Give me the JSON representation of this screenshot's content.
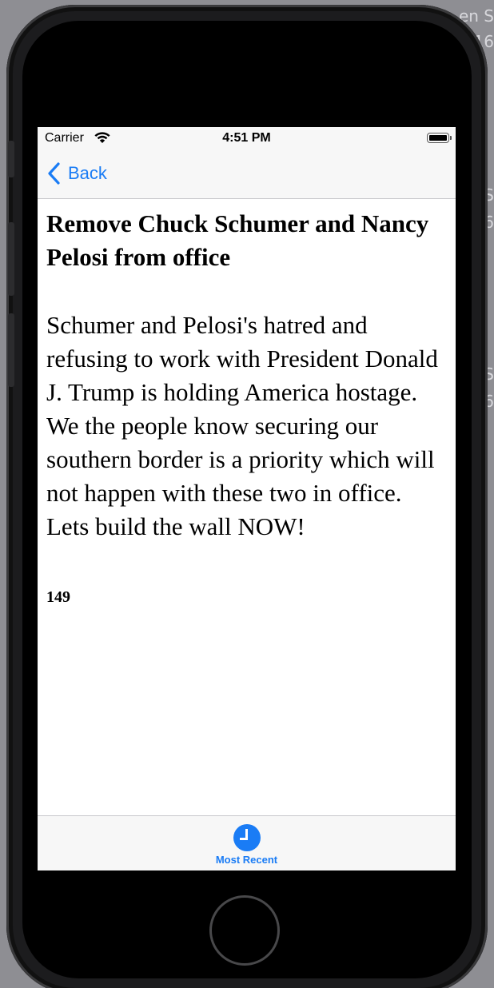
{
  "background": {
    "fragments": [
      "en S",
      "16",
      "S",
      "6",
      "S",
      "6"
    ]
  },
  "status_bar": {
    "carrier": "Carrier",
    "time": "4:51 PM"
  },
  "nav_bar": {
    "back_label": "Back"
  },
  "petition": {
    "title": "Remove Chuck Schumer and Nancy Pelosi from office",
    "body": "Schumer and Pelosi's hatred and refusing to work with President Donald J. Trump is holding America hostage. We the people know securing our southern border is a priority which will not happen with these two in office. Lets build the wall NOW!",
    "count": "149"
  },
  "tab_bar": {
    "items": [
      {
        "label": "Most Recent",
        "icon": "clock-icon",
        "selected": true
      }
    ]
  },
  "colors": {
    "accent": "#1a7cf5",
    "bar_background": "#f7f7f7"
  }
}
